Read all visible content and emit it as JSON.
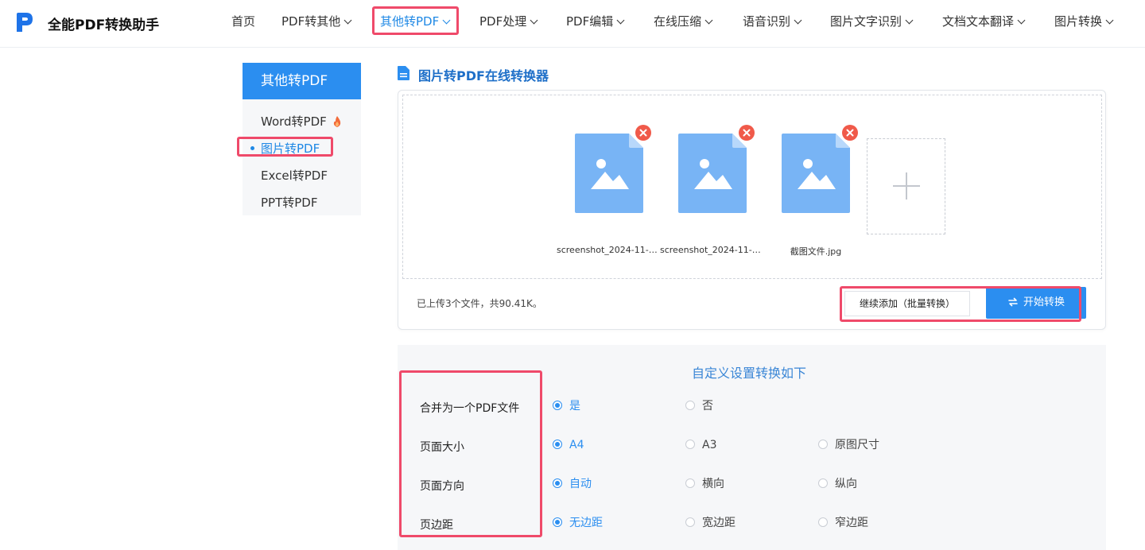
{
  "brand": {
    "title": "全能PDF转换助手"
  },
  "nav": {
    "items": [
      {
        "label": "首页"
      },
      {
        "label": "PDF转其他"
      },
      {
        "label": "其他转PDF"
      },
      {
        "label": "PDF处理"
      },
      {
        "label": "PDF编辑"
      },
      {
        "label": "在线压缩"
      },
      {
        "label": "语音识别"
      },
      {
        "label": "图片文字识别"
      },
      {
        "label": "文档文本翻译"
      },
      {
        "label": "图片转换"
      }
    ],
    "active_index": 2
  },
  "sidebar": {
    "heading": "其他转PDF",
    "items": [
      {
        "label": "Word转PDF"
      },
      {
        "label": "图片转PDF"
      },
      {
        "label": "Excel转PDF"
      },
      {
        "label": "PPT转PDF"
      }
    ],
    "active_index": 1
  },
  "converter": {
    "title": "图片转PDF在线转换器",
    "files": [
      {
        "name": "screenshot_2024-11-1..."
      },
      {
        "name": "screenshot_2024-11-1..."
      },
      {
        "name": "截图文件.jpg"
      }
    ],
    "status": "已上传3个文件，共90.41K。",
    "add_more_label": "继续添加（批量转换）",
    "start_label": "开始转换"
  },
  "settings": {
    "title": "自定义设置转换如下",
    "rows": [
      {
        "label": "合并为一个PDF文件",
        "options": [
          "是",
          "否"
        ],
        "selected": 0
      },
      {
        "label": "页面大小",
        "options": [
          "A4",
          "A3",
          "原图尺寸"
        ],
        "selected": 0
      },
      {
        "label": "页面方向",
        "options": [
          "自动",
          "横向",
          "纵向"
        ],
        "selected": 0
      },
      {
        "label": "页边距",
        "options": [
          "无边距",
          "宽边距",
          "窄边距"
        ],
        "selected": 0
      }
    ]
  },
  "colors": {
    "accent": "#2b8ef0",
    "highlight": "#ef4a6a",
    "file_icon": "#78b4f5",
    "remove": "#f05a4a"
  }
}
